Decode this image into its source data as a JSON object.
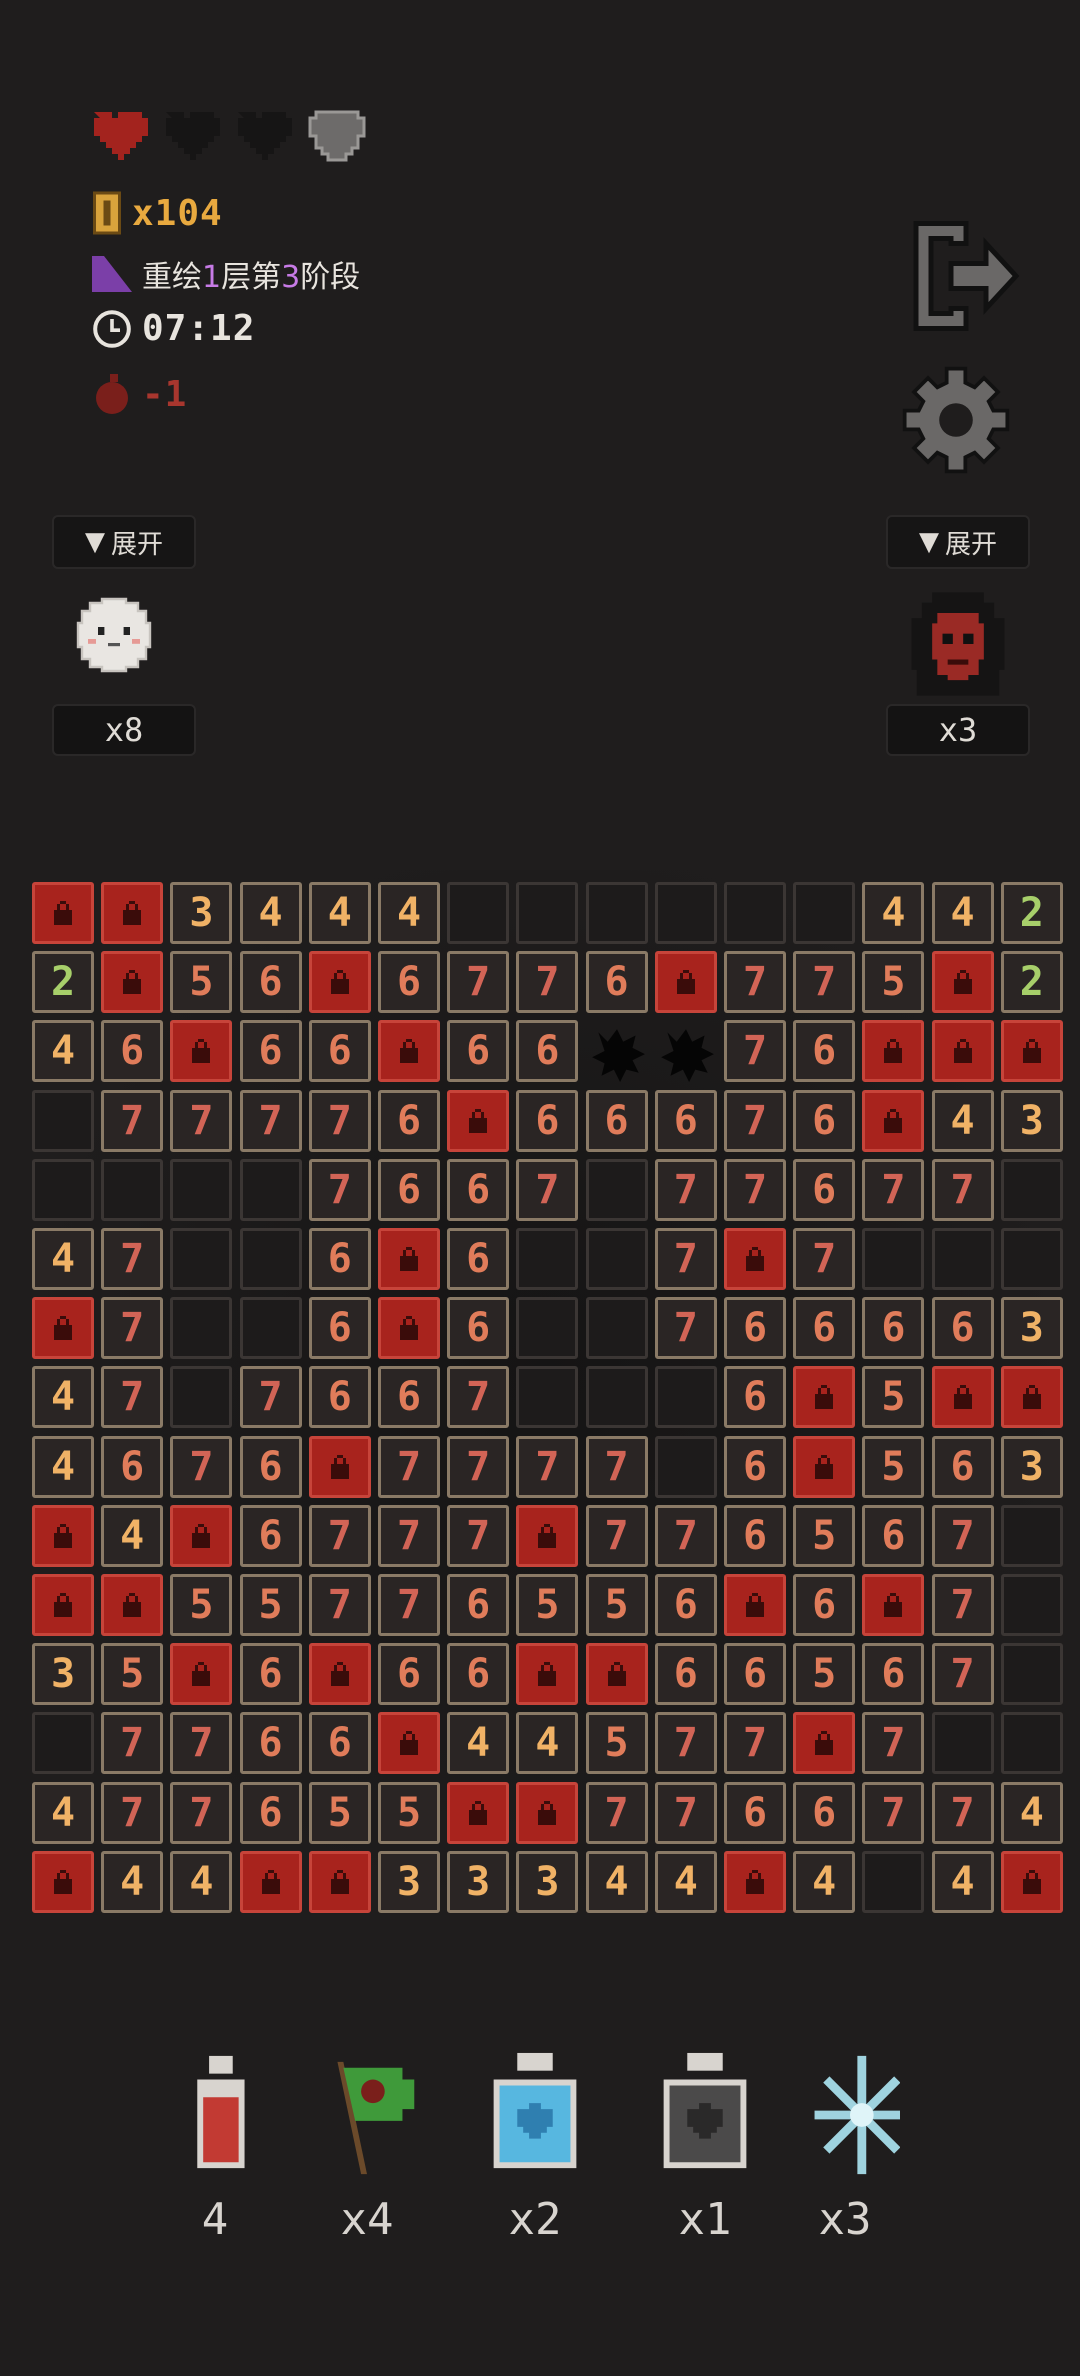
{
  "hud": {
    "hearts": [
      "full",
      "empty",
      "empty",
      "shield"
    ],
    "coins": "x104",
    "stage": {
      "prefix": "重绘",
      "layer": "1",
      "mid": "层第",
      "phase": "3",
      "suffix": "阶段"
    },
    "time": "07:12",
    "bomb_delta": "-1"
  },
  "left_panel": {
    "expand_label": "展开",
    "count": "x8",
    "avatar": "ghost-puff"
  },
  "right_panel": {
    "expand_label": "展开",
    "count": "x3",
    "avatar": "hooded-skull"
  },
  "board": {
    "rows": [
      [
        "L",
        "L",
        "3",
        "4",
        "4",
        "4",
        "E",
        "E",
        "E",
        "E",
        "E",
        "E",
        "4",
        "4",
        "2"
      ],
      [
        "2",
        "L",
        "5",
        "6",
        "L",
        "6",
        "7",
        "7",
        "6",
        "L",
        "7",
        "7",
        "5",
        "L",
        "2"
      ],
      [
        "4",
        "6",
        "L",
        "6",
        "6",
        "L",
        "6",
        "6",
        "B",
        "B",
        "7",
        "6",
        "L",
        "L",
        "L"
      ],
      [
        "E",
        "7",
        "7",
        "7",
        "7",
        "6",
        "L",
        "6",
        "6",
        "6",
        "7",
        "6",
        "L",
        "4",
        "3"
      ],
      [
        "E",
        "E",
        "E",
        "E",
        "7",
        "6",
        "6",
        "7",
        "E",
        "7",
        "7",
        "6",
        "7",
        "7",
        "E"
      ],
      [
        "4",
        "7",
        "E",
        "E",
        "6",
        "L",
        "6",
        "E",
        "E",
        "7",
        "L",
        "7",
        "E",
        "E",
        "E"
      ],
      [
        "L",
        "7",
        "E",
        "E",
        "6",
        "L",
        "6",
        "E",
        "E",
        "7",
        "6",
        "6",
        "6",
        "6",
        "3"
      ],
      [
        "4",
        "7",
        "E",
        "7",
        "6",
        "6",
        "7",
        "E",
        "E",
        "E",
        "6",
        "L",
        "5",
        "L",
        "L"
      ],
      [
        "4",
        "6",
        "7",
        "6",
        "L",
        "7",
        "7",
        "7",
        "7",
        "E",
        "6",
        "L",
        "5",
        "6",
        "3"
      ],
      [
        "L",
        "4",
        "L",
        "6",
        "7",
        "7",
        "7",
        "L",
        "7",
        "7",
        "6",
        "5",
        "6",
        "7",
        "E"
      ],
      [
        "L",
        "L",
        "5",
        "5",
        "7",
        "7",
        "6",
        "5",
        "5",
        "6",
        "L",
        "6",
        "L",
        "7",
        "E"
      ],
      [
        "3",
        "5",
        "L",
        "6",
        "L",
        "6",
        "6",
        "L",
        "L",
        "6",
        "6",
        "5",
        "6",
        "7",
        "E"
      ],
      [
        "E",
        "7",
        "7",
        "6",
        "6",
        "L",
        "4",
        "4",
        "5",
        "7",
        "7",
        "L",
        "7",
        "E",
        "E"
      ],
      [
        "4",
        "7",
        "7",
        "6",
        "5",
        "5",
        "L",
        "L",
        "7",
        "7",
        "6",
        "6",
        "7",
        "7",
        "4"
      ],
      [
        "L",
        "4",
        "4",
        "L",
        "L",
        "3",
        "3",
        "3",
        "4",
        "4",
        "L",
        "4",
        "E",
        "4",
        "L"
      ]
    ]
  },
  "items": [
    {
      "name": "red-potion",
      "label": "4"
    },
    {
      "name": "green-flag",
      "label": "x4"
    },
    {
      "name": "blue-heart-potion",
      "label": "x2"
    },
    {
      "name": "gray-potion",
      "label": "x1"
    },
    {
      "name": "ice-crystal",
      "label": "x3"
    }
  ],
  "colors": {
    "lock": "#a8231d",
    "number_border": "#8a7a66",
    "background": "#1f1d1d"
  }
}
